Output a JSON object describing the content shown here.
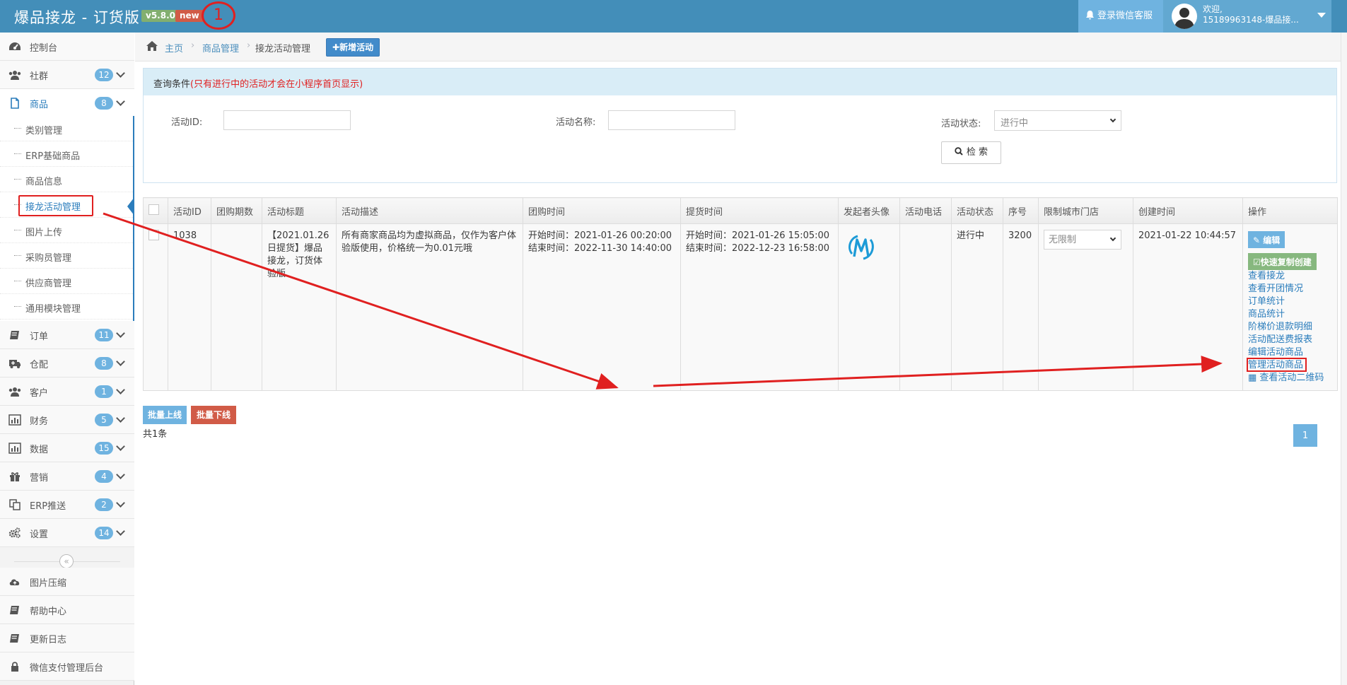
{
  "header": {
    "title": "爆品接龙 - 订货版",
    "version": "v5.8.0",
    "new_badge": "new",
    "annotation_number": "1",
    "wechat_service": "登录微信客服",
    "welcome": "欢迎,",
    "username": "15189963148-爆品接..."
  },
  "sidebar": {
    "items": [
      {
        "label": "控制台",
        "icon": "dashboard-icon"
      },
      {
        "label": "社群",
        "count": "12",
        "icon": "group-icon"
      },
      {
        "label": "商品",
        "count": "8",
        "icon": "file-icon"
      },
      {
        "label": "订单",
        "count": "11",
        "icon": "book-icon"
      },
      {
        "label": "仓配",
        "count": "8",
        "icon": "ambulance-icon"
      },
      {
        "label": "客户",
        "count": "1",
        "icon": "group-icon"
      },
      {
        "label": "财务",
        "count": "5",
        "icon": "bar-chart-icon"
      },
      {
        "label": "数据",
        "count": "15",
        "icon": "bar-chart-icon"
      },
      {
        "label": "营销",
        "count": "4",
        "icon": "gift-icon"
      },
      {
        "label": "ERP推送",
        "count": "2",
        "icon": "copy-icon"
      },
      {
        "label": "设置",
        "count": "14",
        "icon": "cogs-icon"
      }
    ],
    "sub_items": [
      "类别管理",
      "ERP基础商品",
      "商品信息",
      "接龙活动管理",
      "图片上传",
      "采购员管理",
      "供应商管理",
      "通用模块管理"
    ],
    "bottom_items": [
      {
        "label": "图片压缩",
        "icon": "cloud-upload-icon"
      },
      {
        "label": "帮助中心",
        "icon": "book-icon"
      },
      {
        "label": "更新日志",
        "icon": "book-icon"
      },
      {
        "label": "微信支付管理后台",
        "icon": "lock-icon"
      }
    ]
  },
  "breadcrumb": {
    "home": "主页",
    "section": "商品管理",
    "current": "接龙活动管理",
    "add_button": "新增活动"
  },
  "query": {
    "title": "查询条件",
    "note": "(只有进行中的活动才会在小程序首页显示)",
    "id_label": "活动ID:",
    "name_label": "活动名称:",
    "status_label": "活动状态:",
    "status_value": "进行中",
    "search_button": "检 索"
  },
  "table": {
    "columns": [
      "活动ID",
      "团购期数",
      "活动标题",
      "活动描述",
      "团购时间",
      "提货时间",
      "发起者头像",
      "活动电话",
      "活动状态",
      "序号",
      "限制城市门店",
      "创建时间",
      "操作"
    ],
    "rows": [
      {
        "id": "1038",
        "period": "",
        "title": "【2021.01.26日提货】爆品接龙，订货体验版",
        "desc": "所有商家商品均为虚拟商品，仅作为客户体验版使用，价格统一为0.01元哦",
        "group_start": "开始时间：2021-01-26 00:20:00",
        "group_end": "结束时间：2022-11-30 14:40:00",
        "pickup_start": "开始时间：2021-01-26 15:05:00",
        "pickup_end": "结束时间：2022-12-23 16:58:00",
        "phone": "",
        "status": "进行中",
        "seq": "3200",
        "city": "无限制",
        "created": "2021-01-22 10:44:57",
        "edit": "编辑",
        "copy": "快速复制创建",
        "links": [
          "查看接龙",
          "查看开团情况",
          "订单统计",
          "商品统计",
          "阶梯价退款明细",
          "活动配送费报表",
          "编辑活动商品",
          "管理活动商品"
        ],
        "qr_link": "查看活动二维码"
      }
    ]
  },
  "footer": {
    "batch_on": "批量上线",
    "batch_off": "批量下线",
    "total": "共1条",
    "page": "1"
  },
  "colors": {
    "header": "#438eb9",
    "accent": "#6fb3e0",
    "danger": "#d15b47",
    "success": "#87b87f",
    "annotation": "#e02020"
  }
}
